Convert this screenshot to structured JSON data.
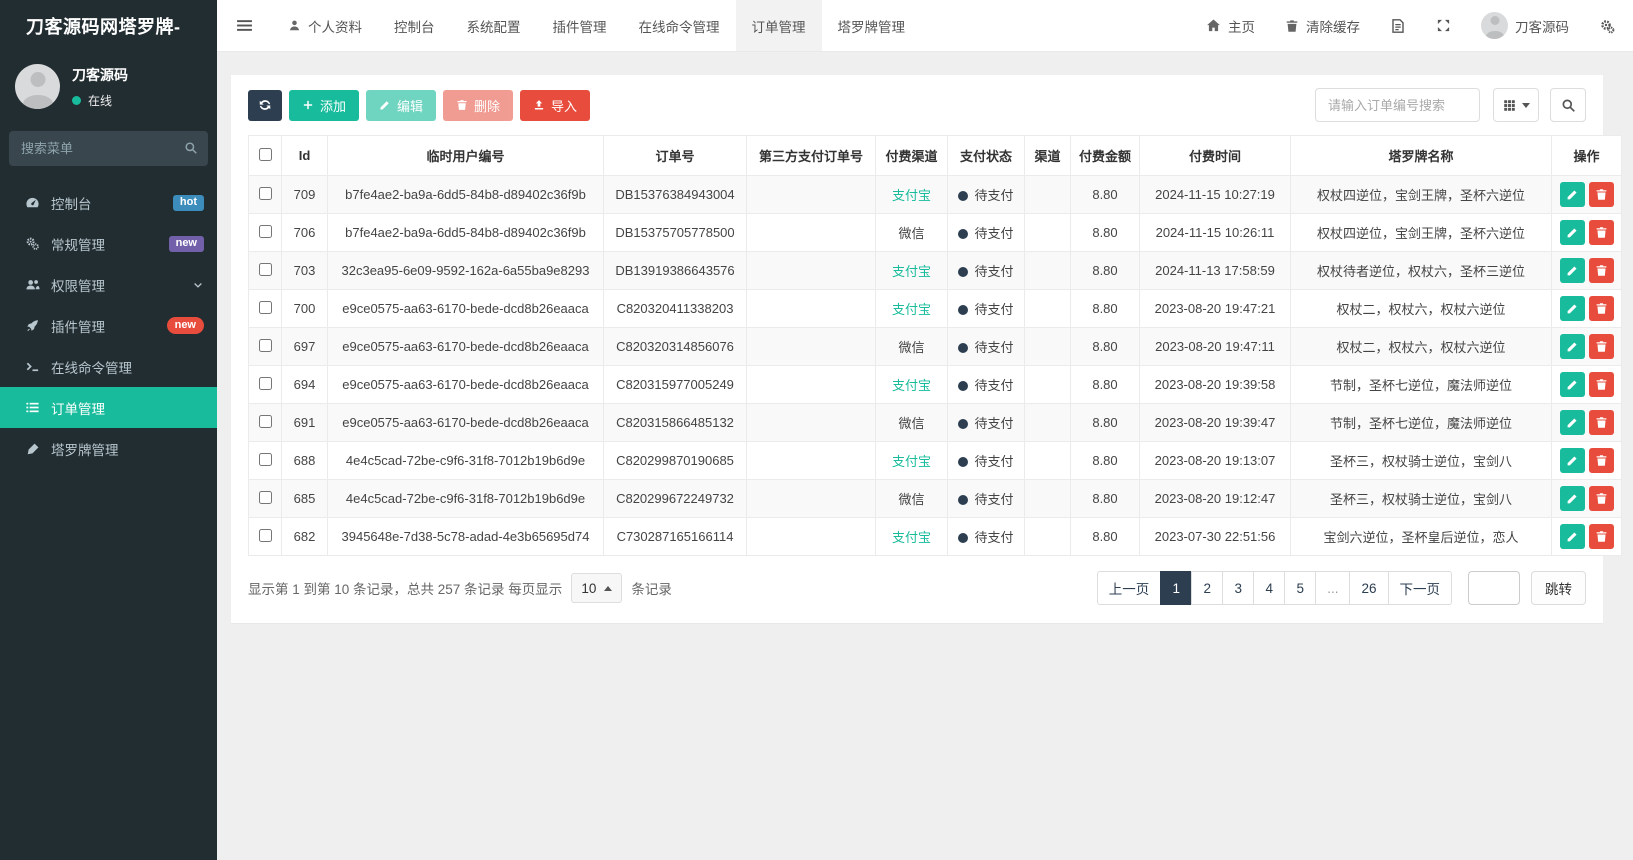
{
  "app": {
    "title": "刀客源码网塔罗牌-"
  },
  "sidebar": {
    "user": {
      "name": "刀客源码",
      "status": "在线"
    },
    "search_placeholder": "搜索菜单",
    "items": [
      {
        "label": "控制台",
        "icon": "dashboard-icon",
        "badge": {
          "text": "hot",
          "color": "#3c8dbc",
          "pill": false
        }
      },
      {
        "label": "常规管理",
        "icon": "gears-icon",
        "badge": {
          "text": "new",
          "color": "#7261aa",
          "pill": false
        }
      },
      {
        "label": "权限管理",
        "icon": "users-icon",
        "chevron": true
      },
      {
        "label": "插件管理",
        "icon": "rocket-icon",
        "badge": {
          "text": "new",
          "color": "#e74c3c",
          "pill": true
        }
      },
      {
        "label": "在线命令管理",
        "icon": "terminal-icon"
      },
      {
        "label": "订单管理",
        "icon": "list-icon",
        "active": true
      },
      {
        "label": "塔罗牌管理",
        "icon": "tarot-icon"
      }
    ]
  },
  "topnav": {
    "tabs": [
      {
        "label": "个人资料",
        "icon": "user-icon"
      },
      {
        "label": "控制台"
      },
      {
        "label": "系统配置"
      },
      {
        "label": "插件管理"
      },
      {
        "label": "在线命令管理"
      },
      {
        "label": "订单管理",
        "active": true
      },
      {
        "label": "塔罗牌管理"
      }
    ],
    "home": "主页",
    "clear_cache": "清除缓存",
    "username": "刀客源码"
  },
  "toolbar": {
    "add": "添加",
    "edit": "编辑",
    "delete": "删除",
    "import": "导入",
    "search_placeholder": "请输入订单编号搜索"
  },
  "table": {
    "columns": [
      "Id",
      "临时用户编号",
      "订单号",
      "第三方支付订单号",
      "付费渠道",
      "支付状态",
      "渠道",
      "付费金额",
      "付费时间",
      "塔罗牌名称",
      "操作"
    ],
    "rows": [
      {
        "id": "709",
        "temp_user_no": "b7fe4ae2-ba9a-6dd5-84b8-d89402c36f9b",
        "order_no": "DB15376384943004",
        "third_order_no": "",
        "pay_channel": "支付宝",
        "pay_status": "待支付",
        "channel": "",
        "amount": "8.80",
        "pay_time": "2024-11-15 10:27:19",
        "tarot_names": "权杖四逆位，宝剑王牌，圣杯六逆位"
      },
      {
        "id": "706",
        "temp_user_no": "b7fe4ae2-ba9a-6dd5-84b8-d89402c36f9b",
        "order_no": "DB15375705778500",
        "third_order_no": "",
        "pay_channel": "微信",
        "pay_status": "待支付",
        "channel": "",
        "amount": "8.80",
        "pay_time": "2024-11-15 10:26:11",
        "tarot_names": "权杖四逆位，宝剑王牌，圣杯六逆位"
      },
      {
        "id": "703",
        "temp_user_no": "32c3ea95-6e09-9592-162a-6a55ba9e8293",
        "order_no": "DB13919386643576",
        "third_order_no": "",
        "pay_channel": "支付宝",
        "pay_status": "待支付",
        "channel": "",
        "amount": "8.80",
        "pay_time": "2024-11-13 17:58:59",
        "tarot_names": "权杖待者逆位，权杖六，圣杯三逆位"
      },
      {
        "id": "700",
        "temp_user_no": "e9ce0575-aa63-6170-bede-dcd8b26eaaca",
        "order_no": "C820320411338203",
        "third_order_no": "",
        "pay_channel": "支付宝",
        "pay_status": "待支付",
        "channel": "",
        "amount": "8.80",
        "pay_time": "2023-08-20 19:47:21",
        "tarot_names": "权杖二，权杖六，权杖六逆位"
      },
      {
        "id": "697",
        "temp_user_no": "e9ce0575-aa63-6170-bede-dcd8b26eaaca",
        "order_no": "C820320314856076",
        "third_order_no": "",
        "pay_channel": "微信",
        "pay_status": "待支付",
        "channel": "",
        "amount": "8.80",
        "pay_time": "2023-08-20 19:47:11",
        "tarot_names": "权杖二，权杖六，权杖六逆位"
      },
      {
        "id": "694",
        "temp_user_no": "e9ce0575-aa63-6170-bede-dcd8b26eaaca",
        "order_no": "C820315977005249",
        "third_order_no": "",
        "pay_channel": "支付宝",
        "pay_status": "待支付",
        "channel": "",
        "amount": "8.80",
        "pay_time": "2023-08-20 19:39:58",
        "tarot_names": "节制，圣杯七逆位，魔法师逆位"
      },
      {
        "id": "691",
        "temp_user_no": "e9ce0575-aa63-6170-bede-dcd8b26eaaca",
        "order_no": "C820315866485132",
        "third_order_no": "",
        "pay_channel": "微信",
        "pay_status": "待支付",
        "channel": "",
        "amount": "8.80",
        "pay_time": "2023-08-20 19:39:47",
        "tarot_names": "节制，圣杯七逆位，魔法师逆位"
      },
      {
        "id": "688",
        "temp_user_no": "4e4c5cad-72be-c9f6-31f8-7012b19b6d9e",
        "order_no": "C820299870190685",
        "third_order_no": "",
        "pay_channel": "支付宝",
        "pay_status": "待支付",
        "channel": "",
        "amount": "8.80",
        "pay_time": "2023-08-20 19:13:07",
        "tarot_names": "圣杯三，权杖骑士逆位，宝剑八"
      },
      {
        "id": "685",
        "temp_user_no": "4e4c5cad-72be-c9f6-31f8-7012b19b6d9e",
        "order_no": "C820299672249732",
        "third_order_no": "",
        "pay_channel": "微信",
        "pay_status": "待支付",
        "channel": "",
        "amount": "8.80",
        "pay_time": "2023-08-20 19:12:47",
        "tarot_names": "圣杯三，权杖骑士逆位，宝剑八"
      },
      {
        "id": "682",
        "temp_user_no": "3945648e-7d38-5c78-adad-4e3b65695d74",
        "order_no": "C730287165166114",
        "third_order_no": "",
        "pay_channel": "支付宝",
        "pay_status": "待支付",
        "channel": "",
        "amount": "8.80",
        "pay_time": "2023-07-30 22:51:56",
        "tarot_names": "宝剑六逆位，圣杯皇后逆位，恋人"
      }
    ]
  },
  "pagination": {
    "info_prefix": "显示第 1 到第 10 条记录，总共 257 条记录 每页显示",
    "page_size": "10",
    "info_suffix": "条记录",
    "prev": "上一页",
    "pages": [
      "1",
      "2",
      "3",
      "4",
      "5",
      "...",
      "26"
    ],
    "active_page": "1",
    "next": "下一页",
    "jump": "跳转"
  },
  "colors": {
    "accent": "#18bc9c",
    "danger": "#e74c3c",
    "dark": "#2c3e50"
  }
}
